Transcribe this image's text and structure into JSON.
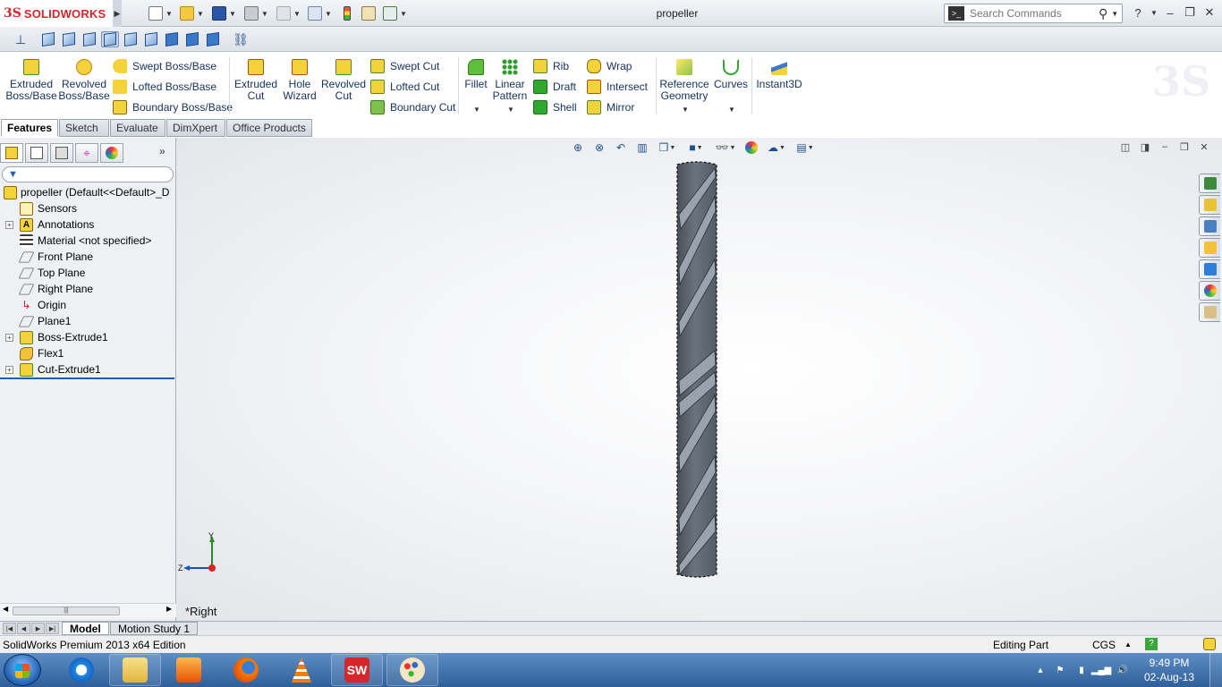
{
  "app": {
    "logo_text": "SOLIDWORKS",
    "logo_mark": "3S",
    "document_title": "propeller"
  },
  "search": {
    "placeholder": "Search Commands"
  },
  "ribbon": {
    "extruded_boss": "Extruded\nBoss/Base",
    "revolved_boss": "Revolved\nBoss/Base",
    "swept_boss": "Swept Boss/Base",
    "lofted_boss": "Lofted Boss/Base",
    "boundary_boss": "Boundary Boss/Base",
    "extruded_cut": "Extruded\nCut",
    "hole_wizard": "Hole\nWizard",
    "revolved_cut": "Revolved\nCut",
    "swept_cut": "Swept Cut",
    "lofted_cut": "Lofted Cut",
    "boundary_cut": "Boundary Cut",
    "fillet": "Fillet",
    "linear_pattern": "Linear\nPattern",
    "rib": "Rib",
    "draft": "Draft",
    "shell": "Shell",
    "wrap": "Wrap",
    "intersect": "Intersect",
    "mirror": "Mirror",
    "reference_geometry": "Reference\nGeometry",
    "curves": "Curves",
    "instant3d": "Instant3D"
  },
  "cm_tabs": [
    "Features",
    "Sketch",
    "Evaluate",
    "DimXpert",
    "Office Products"
  ],
  "tree": {
    "root": "propeller  (Default<<Default>_D",
    "items": [
      {
        "label": "Sensors",
        "expandable": false
      },
      {
        "label": "Annotations",
        "expandable": true
      },
      {
        "label": "Material <not specified>",
        "expandable": false
      },
      {
        "label": "Front Plane",
        "expandable": false
      },
      {
        "label": "Top Plane",
        "expandable": false
      },
      {
        "label": "Right Plane",
        "expandable": false
      },
      {
        "label": "Origin",
        "expandable": false
      },
      {
        "label": "Plane1",
        "expandable": false
      },
      {
        "label": "Boss-Extrude1",
        "expandable": true
      },
      {
        "label": "Flex1",
        "expandable": false
      },
      {
        "label": "Cut-Extrude1",
        "expandable": true
      }
    ]
  },
  "graphics": {
    "view_label": "*Right",
    "triad_y": "Y",
    "triad_z": "Z"
  },
  "bottom_tabs": [
    "Model",
    "Motion Study 1"
  ],
  "status": {
    "edition": "SolidWorks Premium 2013 x64 Edition",
    "mode": "Editing Part",
    "units": "CGS"
  },
  "taskbar": {
    "time": "9:49 PM",
    "date": "02-Aug-13"
  },
  "colors": {
    "brand_red": "#d7262b",
    "accent_blue": "#1f5cb8",
    "part_gray": "#5f6670"
  }
}
